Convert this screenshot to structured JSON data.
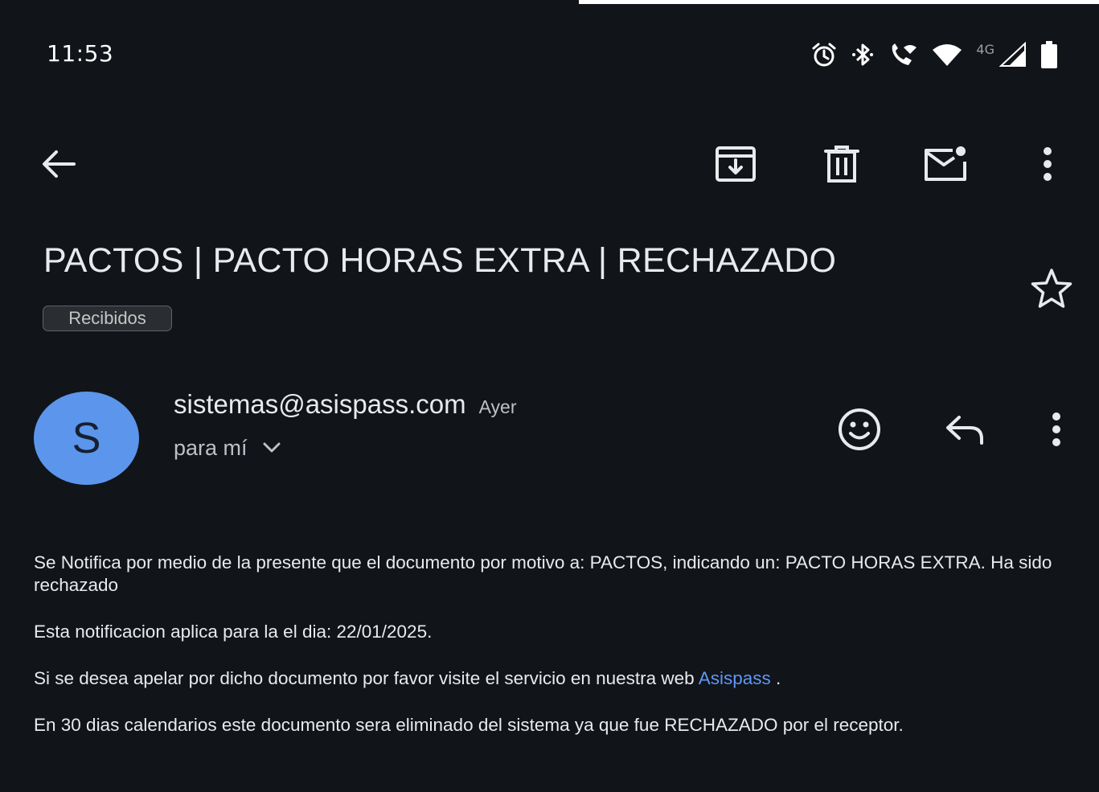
{
  "status_bar": {
    "time": "11:53",
    "network_label": "4G",
    "icons": [
      "alarm-icon",
      "bluetooth-icon",
      "wifi-calling-icon",
      "wifi-icon",
      "cell-signal-icon",
      "battery-icon"
    ]
  },
  "toolbar": {
    "icons": [
      "back-arrow-icon",
      "archive-icon",
      "delete-icon",
      "mark-unread-icon",
      "more-vert-icon"
    ]
  },
  "email": {
    "subject": "PACTOS | PACTO HORAS EXTRA | RECHAZADO",
    "label": "Recibidos",
    "sender": {
      "initial": "S",
      "address": "sistemas@asispass.com",
      "time": "Ayer",
      "recipient": "para mí",
      "avatar_color": "#5b95ec"
    },
    "body": {
      "paragraph1": "Se Notifica por medio de la presente que el documento por motivo a: PACTOS, indicando un: PACTO HORAS EXTRA. Ha sido rechazado",
      "paragraph2": "Esta notificacion aplica para la el dia: 22/01/2025.",
      "paragraph3_before": "Si se desea apelar por dicho documento por favor visite el servicio en nuestra web ",
      "paragraph3_link": "Asispass",
      "paragraph3_after": " .",
      "paragraph4": "En 30 dias calendarios este documento sera eliminado del sistema ya que fue RECHAZADO por el receptor."
    }
  },
  "colors": {
    "background": "#111418",
    "link": "#5e97f6",
    "text": "#e8eaed"
  }
}
